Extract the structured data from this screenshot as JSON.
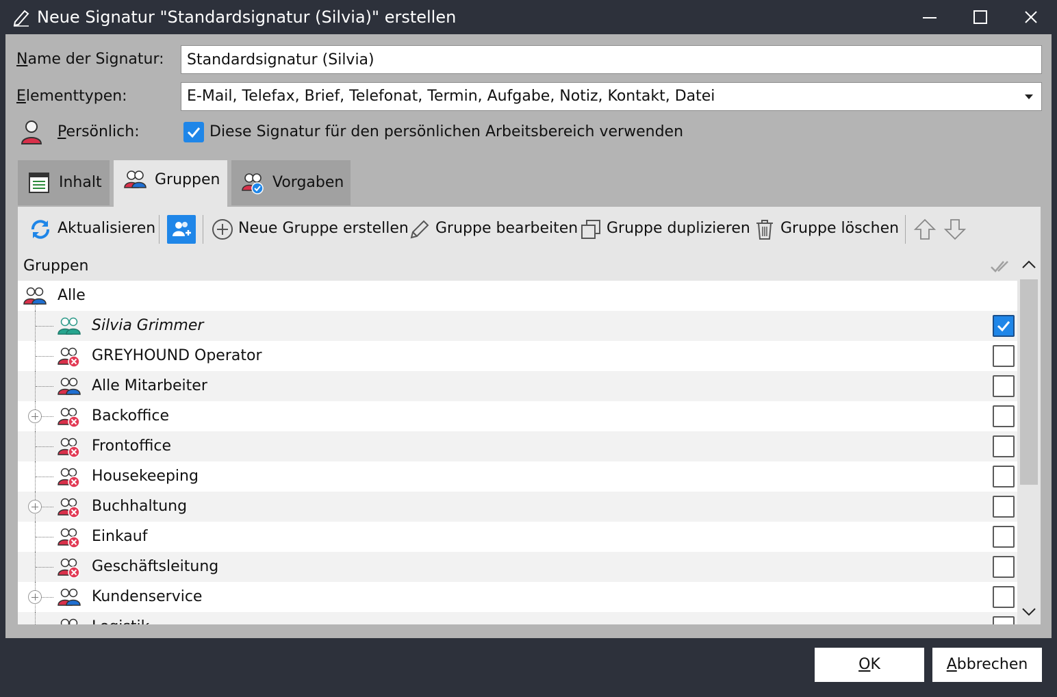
{
  "window": {
    "title": "Neue Signatur \"Standardsignatur (Silvia)\" erstellen"
  },
  "form": {
    "name_label_ul": "N",
    "name_label_rest": "ame der Signatur:",
    "name_value": "Standardsignatur (Silvia)",
    "types_label_ul": "E",
    "types_label_rest": "lementtypen:",
    "types_value": "E-Mail, Telefax, Brief, Telefonat, Termin, Aufgabe, Notiz, Kontakt, Datei",
    "personal_label_ul": "P",
    "personal_label_rest": "ersönlich:",
    "personal_checkbox_text": "Diese Signatur für den persönlichen Arbeitsbereich verwenden",
    "personal_checked": true
  },
  "tabs": [
    {
      "label": "Inhalt",
      "icon": "document-list-icon",
      "active": false
    },
    {
      "label": "Gruppen",
      "icon": "group-icon",
      "active": true
    },
    {
      "label": "Vorgaben",
      "icon": "group-settings-icon",
      "active": false
    }
  ],
  "toolbar": {
    "refresh": "Aktualisieren",
    "new_group": "Neue Gruppe erstellen",
    "edit_group": "Gruppe bearbeiten",
    "duplicate_group": "Gruppe duplizieren",
    "delete_group": "Gruppe löschen"
  },
  "list": {
    "header": "Gruppen",
    "rows": [
      {
        "label": "Alle",
        "level": 0,
        "icon": "group-icon",
        "checked": null,
        "expandable": false,
        "italic": false
      },
      {
        "label": "Silvia Grimmer",
        "level": 1,
        "icon": "user-group-green-icon",
        "checked": true,
        "expandable": false,
        "italic": true
      },
      {
        "label": "GREYHOUND Operator",
        "level": 1,
        "icon": "group-denied-icon",
        "checked": false,
        "expandable": false,
        "italic": false
      },
      {
        "label": "Alle Mitarbeiter",
        "level": 1,
        "icon": "group-icon",
        "checked": false,
        "expandable": false,
        "italic": false
      },
      {
        "label": "Backoffice",
        "level": 1,
        "icon": "group-denied-icon",
        "checked": false,
        "expandable": true,
        "italic": false
      },
      {
        "label": "Frontoffice",
        "level": 1,
        "icon": "group-denied-icon",
        "checked": false,
        "expandable": false,
        "italic": false
      },
      {
        "label": "Housekeeping",
        "level": 1,
        "icon": "group-denied-icon",
        "checked": false,
        "expandable": false,
        "italic": false
      },
      {
        "label": "Buchhaltung",
        "level": 1,
        "icon": "group-denied-icon",
        "checked": false,
        "expandable": true,
        "italic": false
      },
      {
        "label": "Einkauf",
        "level": 1,
        "icon": "group-denied-icon",
        "checked": false,
        "expandable": false,
        "italic": false
      },
      {
        "label": "Geschäftsleitung",
        "level": 1,
        "icon": "group-denied-icon",
        "checked": false,
        "expandable": false,
        "italic": false
      },
      {
        "label": "Kundenservice",
        "level": 1,
        "icon": "group-icon",
        "checked": false,
        "expandable": true,
        "italic": false
      },
      {
        "label": "Logistik",
        "level": 1,
        "icon": "group-icon",
        "checked": false,
        "expandable": false,
        "italic": false
      }
    ]
  },
  "buttons": {
    "ok_ul": "O",
    "ok_rest": "K",
    "cancel_ul": "A",
    "cancel_rest": "bbrechen"
  },
  "colors": {
    "accent": "#1f86e8",
    "titlebar": "#2d313b",
    "dialog_bg": "#b4b4b4",
    "panel_bg": "#e6e6e6"
  }
}
